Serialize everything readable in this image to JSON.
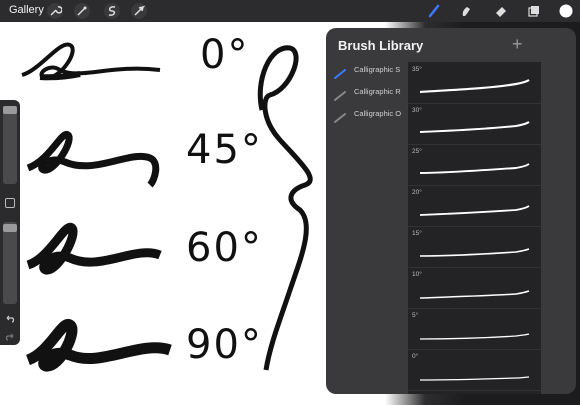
{
  "toolbar": {
    "gallery_label": "Gallery",
    "icons": [
      "wrench-icon",
      "adjustments-icon",
      "selection-icon",
      "transform-arrow-icon",
      "brush-icon",
      "smudge-icon",
      "eraser-icon",
      "layers-icon",
      "color-icon"
    ],
    "accent_color": "#3a7bff"
  },
  "canvas": {
    "angle_labels": [
      "0°",
      "45°",
      "60°",
      "90°"
    ]
  },
  "sidebar": {
    "icons": [
      "modify-square-icon",
      "undo-icon",
      "redo-icon"
    ]
  },
  "brush_library": {
    "title": "Brush Library",
    "add_label": "+",
    "categories": [
      {
        "label": "Calligraphic S",
        "selected": true
      },
      {
        "label": "Calligraphic R",
        "selected": false
      },
      {
        "label": "Calligraphic O",
        "selected": false
      }
    ],
    "brushes": [
      "35°",
      "30°",
      "25°",
      "20°",
      "15°",
      "10°",
      "5°",
      "0°"
    ]
  }
}
